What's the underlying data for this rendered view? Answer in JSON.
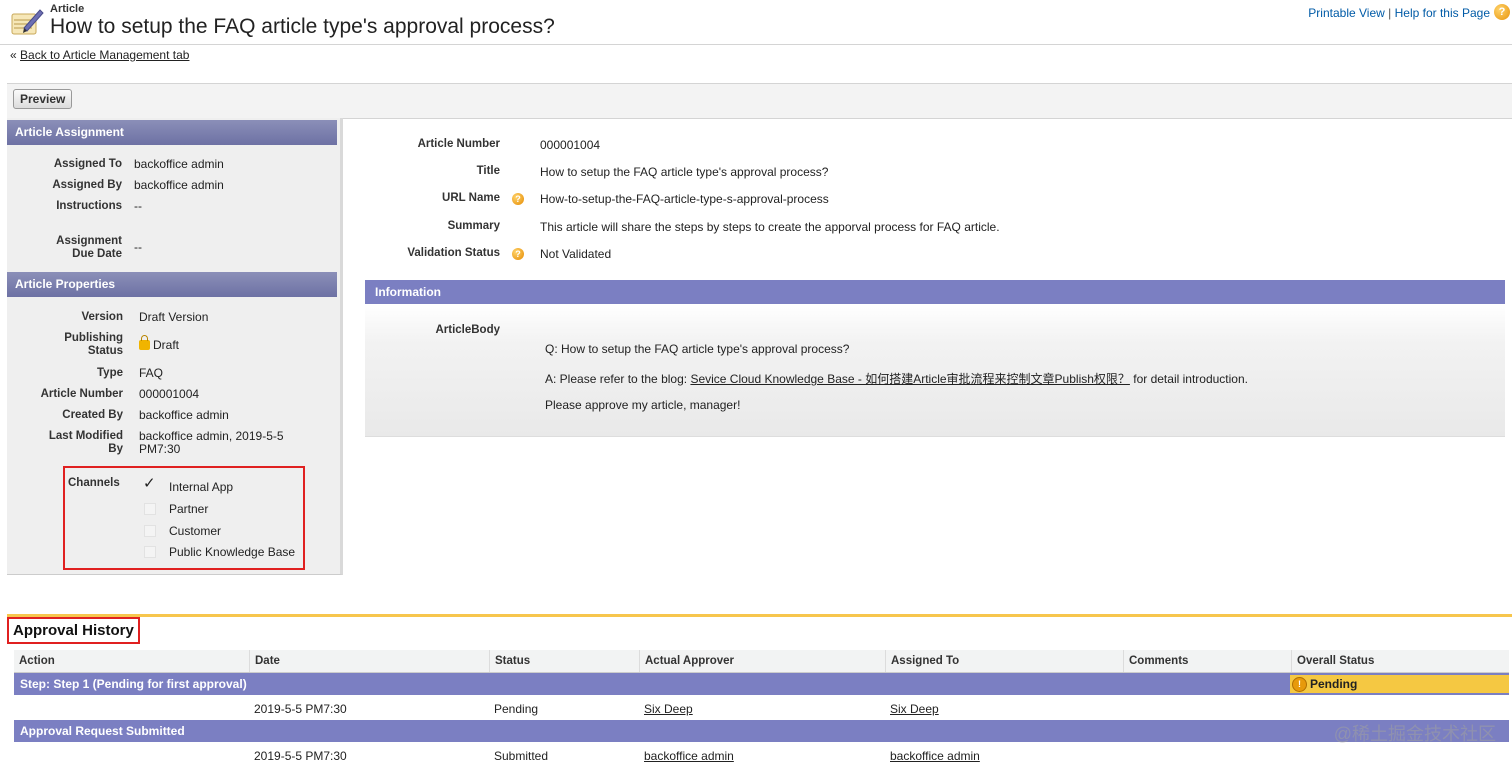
{
  "header": {
    "type": "Article",
    "title": "How to setup the FAQ article type's approval process?",
    "printable_view": "Printable View",
    "separator": "|",
    "help": "Help for this Page"
  },
  "back_link": {
    "prefix": "«",
    "label": "Back to Article Management tab"
  },
  "toolbar": {
    "preview": "Preview"
  },
  "assignment": {
    "title": "Article Assignment",
    "rows": [
      {
        "label": "Assigned To",
        "value": "backoffice admin"
      },
      {
        "label": "Assigned By",
        "value": "backoffice admin"
      },
      {
        "label": "Instructions",
        "value": "--"
      },
      {
        "label": "Assignment Due Date",
        "value": "--"
      }
    ]
  },
  "properties": {
    "title": "Article Properties",
    "version_label": "Version",
    "version": "Draft Version",
    "publishing_label": "Publishing Status",
    "publishing": "Draft",
    "type_label": "Type",
    "type": "FAQ",
    "number_label": "Article Number",
    "number": "000001004",
    "created_label": "Created By",
    "created": "backoffice admin",
    "modified_label": "Last Modified By",
    "modified": "backoffice admin, 2019-5-5 PM7:30",
    "channels_label": "Channels",
    "channels": [
      {
        "name": "Internal App",
        "checked": true
      },
      {
        "name": "Partner",
        "checked": false
      },
      {
        "name": "Customer",
        "checked": false
      },
      {
        "name": "Public Knowledge Base",
        "checked": false
      }
    ]
  },
  "detail": {
    "article_number_label": "Article Number",
    "article_number": "000001004",
    "title_label": "Title",
    "title": "How to setup the FAQ article type's approval process?",
    "url_label": "URL Name",
    "url": "How-to-setup-the-FAQ-article-type-s-approval-process",
    "summary_label": "Summary",
    "summary": "This article will share the steps by steps to create the apporval process for FAQ article.",
    "validation_label": "Validation Status",
    "validation": "Not Validated"
  },
  "information": {
    "title": "Information",
    "body_label": "ArticleBody",
    "q": "Q: How to setup the FAQ article type's approval process?",
    "a_prefix": "A: Please refer to the blog:",
    "a_link": "Sevice Cloud Knowledge Base - 如何搭建Article审批流程来控制文章Publish权限？",
    "a_suffix": "for detail introduction.",
    "closing": "Please approve my article, manager!"
  },
  "approval": {
    "title": "Approval History",
    "columns": [
      "Action",
      "Date",
      "Status",
      "Actual Approver",
      "Assigned To",
      "Comments",
      "Overall Status"
    ],
    "step1": {
      "label": "Step: Step 1 (Pending for first approval)",
      "overall": "Pending",
      "date": "2019-5-5 PM7:30",
      "status": "Pending",
      "approver": "Six Deep",
      "assigned": "Six Deep"
    },
    "submitted": {
      "label": "Approval Request Submitted",
      "date": "2019-5-5 PM7:30",
      "status": "Submitted",
      "approver": "backoffice admin",
      "assigned": "backoffice admin"
    }
  },
  "watermark": "@稀土掘金技术社区"
}
